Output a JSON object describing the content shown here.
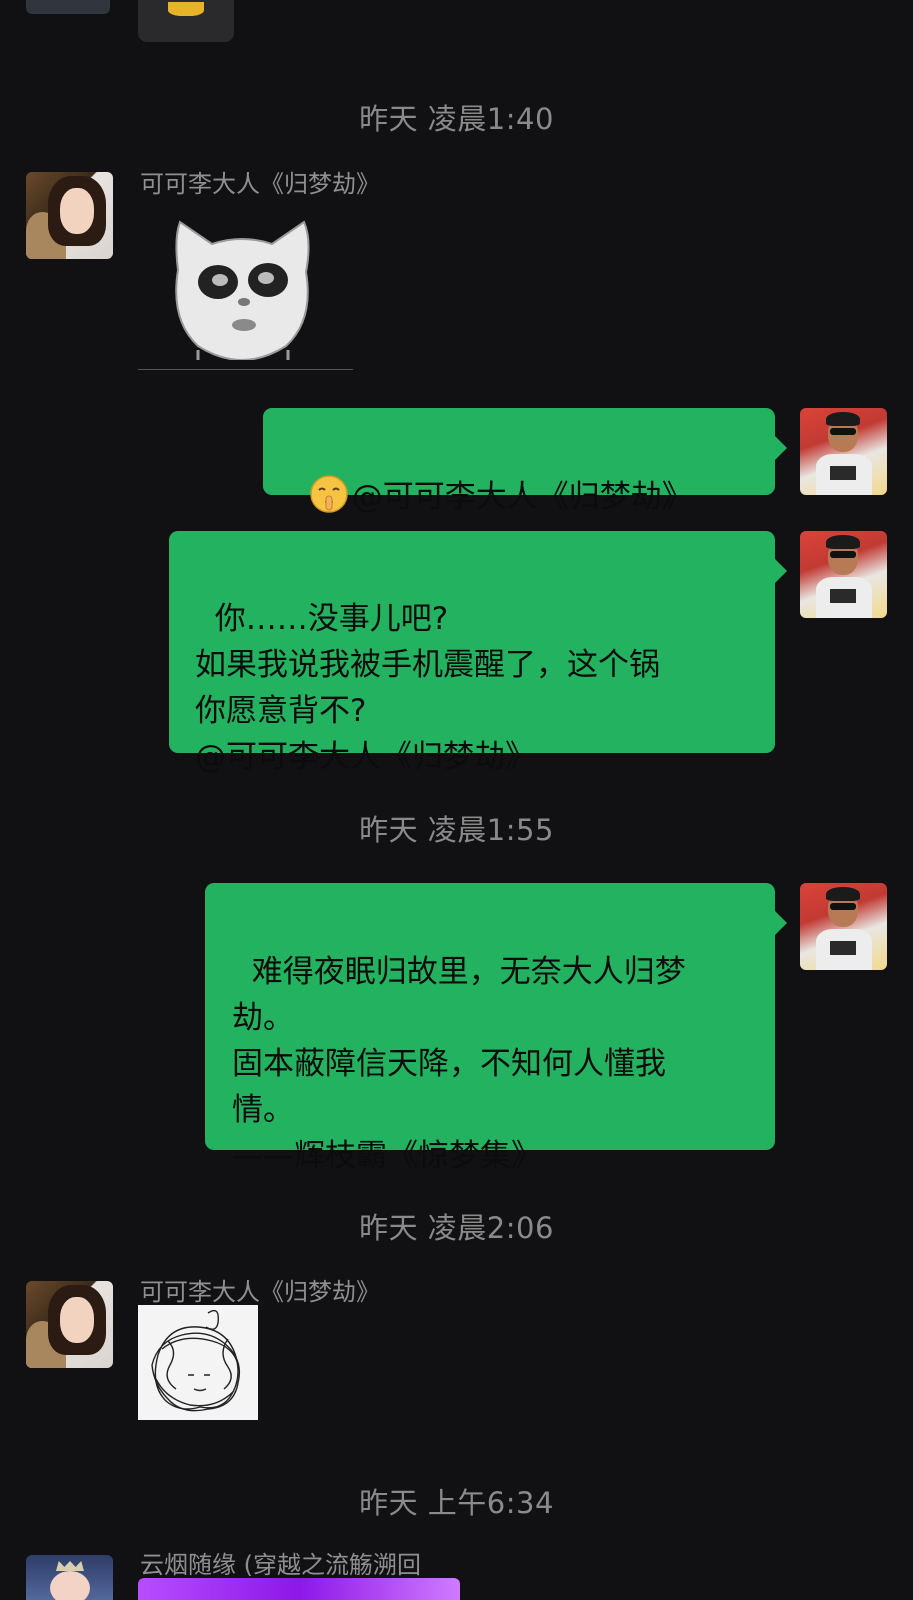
{
  "timestamps": [
    "昨天 凌晨1:40",
    "昨天 凌晨1:55",
    "昨天 凌晨2:06",
    "昨天 上午6:34"
  ],
  "messages": [
    {
      "sender": "可可李大人《归梦劫》",
      "kind": "sticker",
      "sticker_icon": "angry-cat-face-sticker"
    },
    {
      "sender": "me",
      "kind": "text",
      "emoji_icon": "shushing-face-emoji",
      "text": "@可可李大人《归梦劫》"
    },
    {
      "sender": "me",
      "kind": "text",
      "text": "你……没事儿吧?\n如果我说我被手机震醒了，这个锅\n你愿意背不?\n@可可李大人《归梦劫》"
    },
    {
      "sender": "me",
      "kind": "text",
      "text": "难得夜眠归故里，无奈大人归梦\n劫。\n固本蔽障信天降，不知何人懂我\n情。\n——辉枝霸《惊梦集》"
    },
    {
      "sender": "可可李大人《归梦劫》",
      "kind": "sticker",
      "sticker_icon": "scribble-hair-sticker"
    },
    {
      "sender": "云烟随缘 (穿越之流觞溯回",
      "kind": "image",
      "image_icon": "purple-image"
    }
  ],
  "colors": {
    "background": "#111113",
    "outgoing_bubble": "#23b260",
    "timestamp_text": "#8a8a8a",
    "sender_text": "#8f8f8f"
  }
}
